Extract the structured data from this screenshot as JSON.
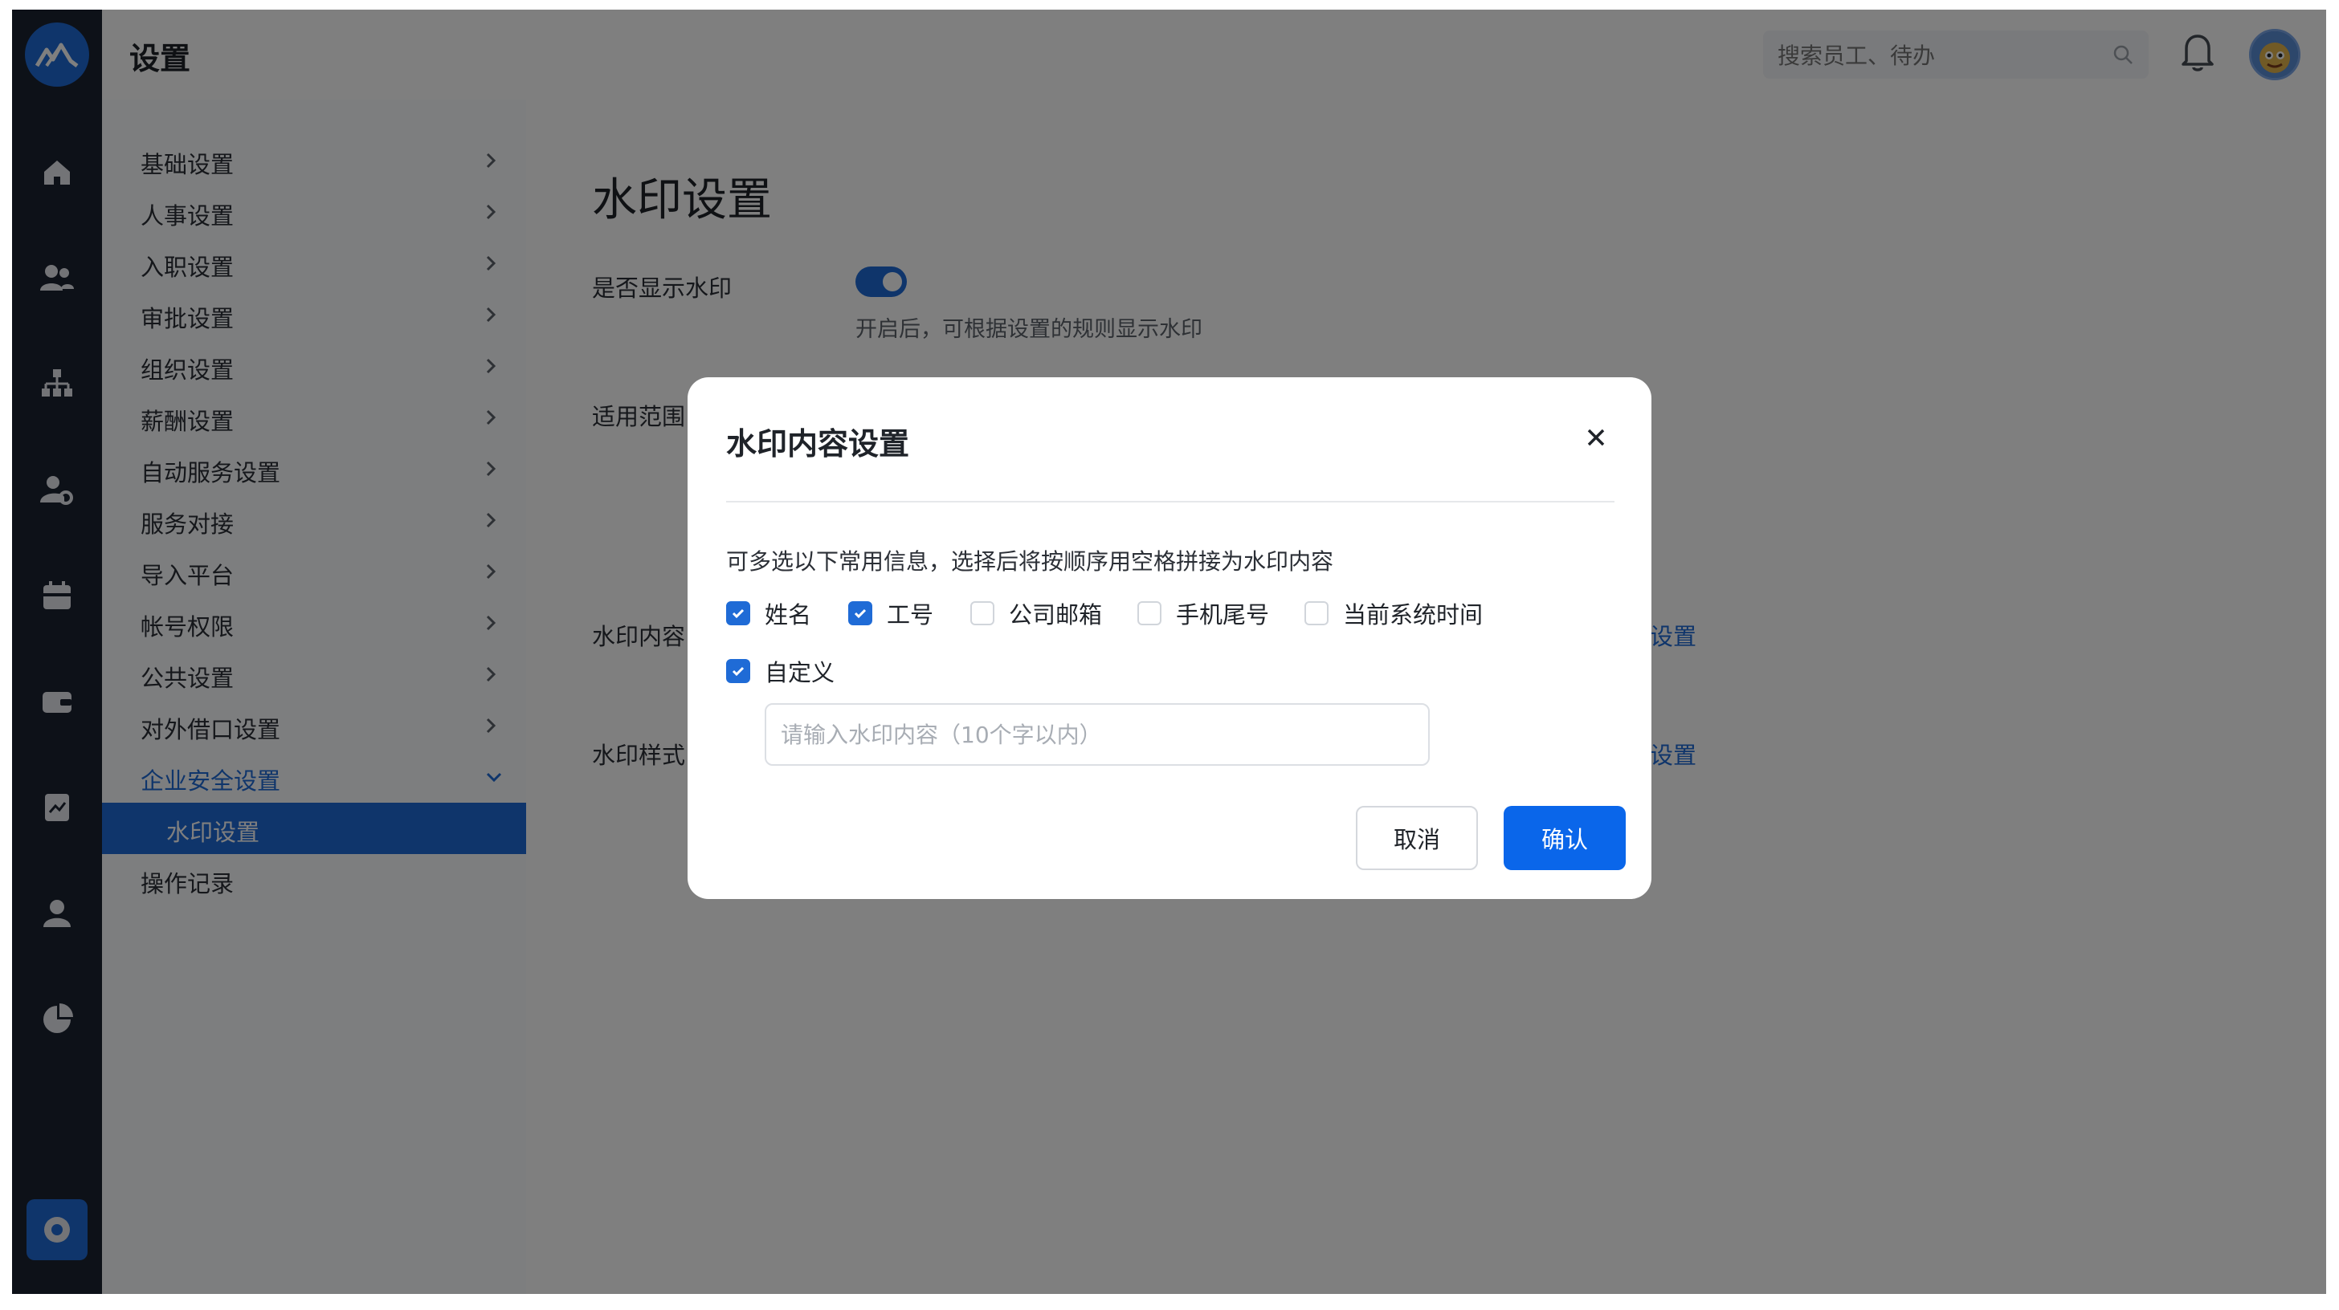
{
  "header": {
    "title": "设置",
    "search_placeholder": "搜索员工、待办"
  },
  "rail": {
    "icons": [
      "home-icon",
      "people-icon",
      "org-chart-icon",
      "user-settings-icon",
      "calendar-icon",
      "wallet-icon",
      "document-icon",
      "person-icon",
      "pie-chart-icon",
      "settings-icon"
    ]
  },
  "menu": {
    "items": [
      {
        "label": "基础设置"
      },
      {
        "label": "人事设置"
      },
      {
        "label": "入职设置"
      },
      {
        "label": "审批设置"
      },
      {
        "label": "组织设置"
      },
      {
        "label": "薪酬设置"
      },
      {
        "label": "自动服务设置"
      },
      {
        "label": "服务对接"
      },
      {
        "label": "导入平台"
      },
      {
        "label": "帐号权限"
      },
      {
        "label": "公共设置"
      },
      {
        "label": "对外借口设置"
      },
      {
        "label": "企业安全设置"
      }
    ],
    "sub_active": "水印设置",
    "last": "操作记录"
  },
  "content": {
    "title": "水印设置",
    "show_label": "是否显示水印",
    "show_hint": "开启后，可根据设置的规则显示水印",
    "scope_label": "适用范围",
    "content_label": "水印内容",
    "style_label": "水印样式",
    "link_text": "设置"
  },
  "modal": {
    "title": "水印内容设置",
    "desc": "可多选以下常用信息，选择后将按顺序用空格拼接为水印内容",
    "options": [
      {
        "label": "姓名",
        "checked": true
      },
      {
        "label": "工号",
        "checked": true
      },
      {
        "label": "公司邮箱",
        "checked": false
      },
      {
        "label": "手机尾号",
        "checked": false
      },
      {
        "label": "当前系统时间",
        "checked": false
      }
    ],
    "custom": {
      "label": "自定义",
      "checked": true
    },
    "custom_placeholder": "请输入水印内容（10个字以内）",
    "cancel": "取消",
    "confirm": "确认"
  },
  "colors": {
    "accent": "#1f6bd6",
    "confirm": "#0a66ea",
    "rail": "#1b2231"
  }
}
